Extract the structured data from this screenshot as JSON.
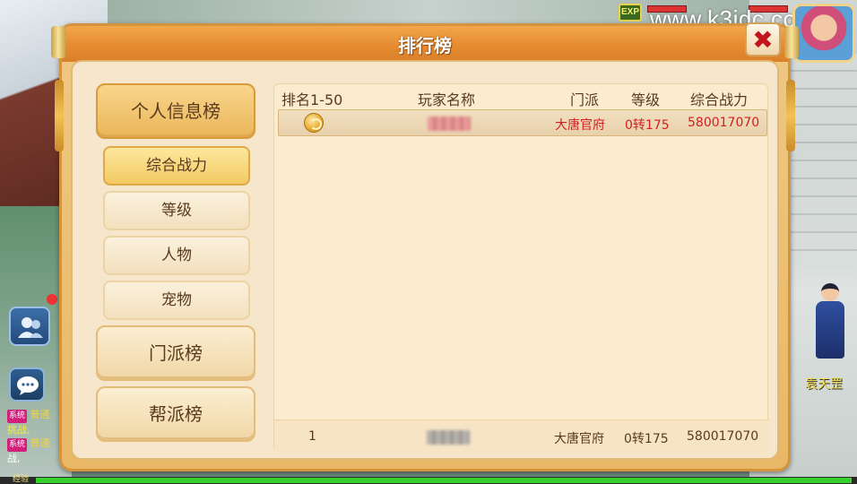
{
  "hud": {
    "exp_badge": "EXP",
    "watermark": "www.k3idc.com",
    "exp_label": "经验"
  },
  "window": {
    "title": "排行榜",
    "close_symbol": "✖"
  },
  "categories": {
    "personal": "个人信息榜",
    "sub": [
      "综合战力",
      "等级",
      "人物",
      "宠物"
    ],
    "sect": "门派榜",
    "guild": "帮派榜"
  },
  "table": {
    "headers": [
      "排名1-50",
      "玩家名称",
      "门派",
      "等级",
      "综合战力"
    ],
    "rows": [
      {
        "rank_icon": "gold-medal-icon",
        "name": "",
        "sect": "大唐官府",
        "level": "0转175",
        "power": "580017070"
      }
    ],
    "my_row": {
      "rank": "1",
      "name": "",
      "sect": "大唐官府",
      "level": "0转175",
      "power": "580017070"
    }
  },
  "chat": {
    "lines": [
      {
        "tag": "系统",
        "channel": "普通",
        "text": "挑战,"
      },
      {
        "tag": "系统",
        "channel": "普通",
        "text": "战,"
      }
    ]
  },
  "npc": {
    "name": "袁天罡"
  },
  "colors": {
    "title_bar": "#e48a2f",
    "highlight_text": "#d11f1f",
    "body_text": "#5a3a1e",
    "active_tab": "#f2c964"
  }
}
